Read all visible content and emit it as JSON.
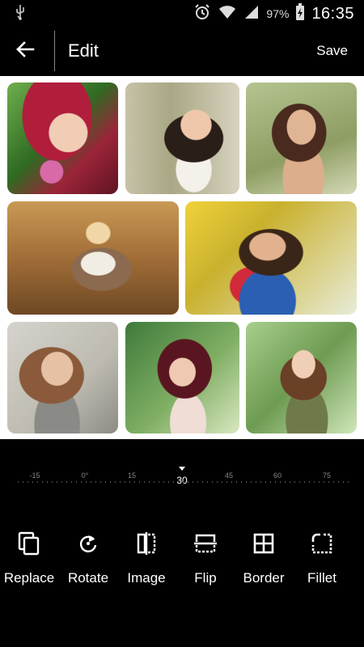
{
  "status_bar": {
    "battery_percent": "97%",
    "time": "16:35",
    "icons": [
      "usb-icon",
      "alarm-icon",
      "wifi-icon",
      "signal-icon",
      "battery-charging-icon"
    ]
  },
  "toolbar": {
    "back_icon": "arrow-left-icon",
    "title": "Edit",
    "save_label": "Save"
  },
  "collage": {
    "photo_count": 8
  },
  "ruler": {
    "labels": [
      "-15",
      "0°",
      "15",
      "45",
      "60",
      "75"
    ],
    "current_value": "30"
  },
  "tools": [
    {
      "label": "Replace",
      "icon": "replace-icon"
    },
    {
      "label": "Rotate",
      "icon": "rotate-icon"
    },
    {
      "label": "Image",
      "icon": "flip-image-icon"
    },
    {
      "label": "Flip",
      "icon": "flip-vertical-icon"
    },
    {
      "label": "Border",
      "icon": "border-icon"
    },
    {
      "label": "Fillet",
      "icon": "fillet-icon"
    }
  ],
  "colors": {
    "background": "#000000",
    "collage_background": "#ffffff",
    "text": "#ffffff",
    "ruler_label": "#888888"
  }
}
